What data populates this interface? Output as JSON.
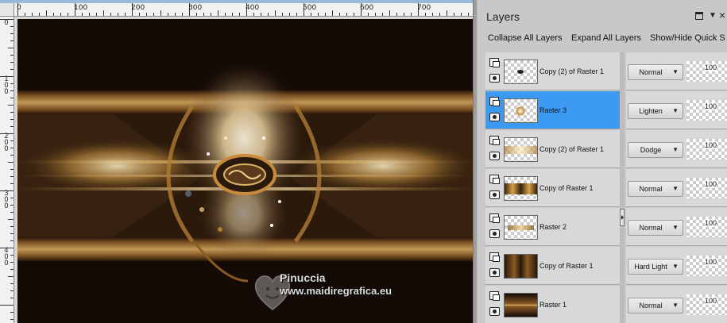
{
  "canvas": {
    "ruler_top_labels": [
      "0",
      "100",
      "200",
      "300",
      "400",
      "500",
      "600",
      "700"
    ],
    "ruler_left_labels": [
      "0",
      "1\n0\n0",
      "2\n0\n0",
      "3\n0\n0",
      "4\n0\n0"
    ],
    "watermark_name": "Pinuccia",
    "watermark_url": "www.maidiregrafica.eu"
  },
  "layers_panel": {
    "title": "Layers",
    "toolbar": {
      "collapse_all": "Collapse All Layers",
      "expand_all": "Expand All Layers",
      "show_hide_quick": "Show/Hide Quick S"
    },
    "layers": [
      {
        "name": "Copy (2) of Raster 1",
        "blend": "Normal",
        "opacity": "100",
        "selected": false
      },
      {
        "name": "Raster 3",
        "blend": "Lighten",
        "opacity": "100",
        "selected": true
      },
      {
        "name": "Copy (2) of Raster 1",
        "blend": "Dodge",
        "opacity": "100",
        "selected": false
      },
      {
        "name": "Copy of Raster 1",
        "blend": "Normal",
        "opacity": "100",
        "selected": false
      },
      {
        "name": "Raster 2",
        "blend": "Normal",
        "opacity": "100",
        "selected": false
      },
      {
        "name": "Copy of Raster 1",
        "blend": "Hard Light",
        "opacity": "100",
        "selected": false
      },
      {
        "name": "Raster 1",
        "blend": "Normal",
        "opacity": "100",
        "selected": false
      }
    ]
  },
  "colors": {
    "selection": "#3d9af3",
    "panel_bg": "#c8c8c8",
    "canvas_dark": "#140b06",
    "gold": "#d9a24a"
  },
  "icons": {
    "close": "×",
    "dropdown": "▼",
    "blend_arrow": "▼",
    "spin": "▲▼"
  }
}
